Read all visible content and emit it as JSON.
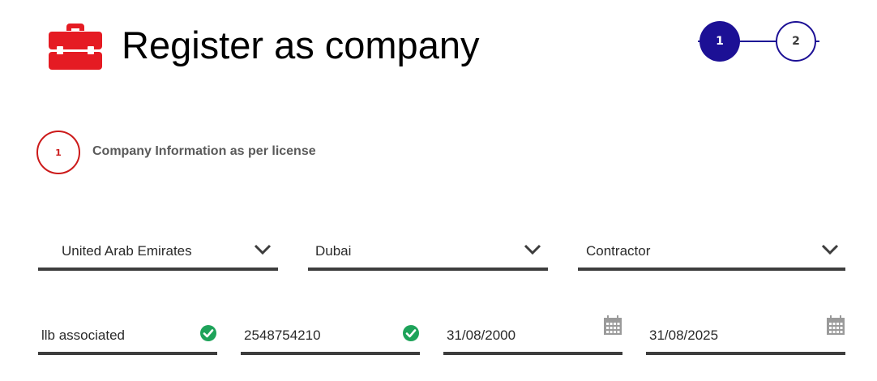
{
  "header": {
    "title": "Register as company",
    "icon": "briefcase-icon",
    "icon_color": "#e51b23"
  },
  "stepper": {
    "steps": [
      {
        "label": "1",
        "state": "active"
      },
      {
        "label": "2",
        "state": "inactive"
      }
    ],
    "active_color": "#1c1095"
  },
  "section": {
    "number": "1",
    "title": "Company Information as per license",
    "badge_color": "#cc1a1a"
  },
  "selects": {
    "country": "United Arab Emirates",
    "city": "Dubai",
    "company_type": "Contractor"
  },
  "fields": {
    "company_name": {
      "value": "llb associated",
      "status": "valid"
    },
    "license_number": {
      "value": "2548754210",
      "status": "valid"
    },
    "issue_date": {
      "value": "31/08/2000"
    },
    "expiry_date": {
      "value": "31/08/2025"
    }
  },
  "colors": {
    "valid": "#1ea35a",
    "underline": "#3d3d3d",
    "calendar": "#9a9a9a"
  }
}
